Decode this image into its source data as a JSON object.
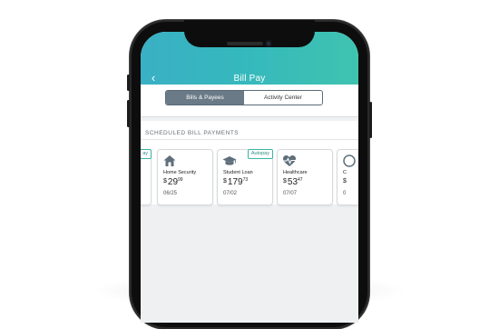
{
  "header": {
    "title": "Bill Pay",
    "back_icon": "chevron-left-icon"
  },
  "tabs": [
    {
      "label": "Bills & Payees",
      "active": true
    },
    {
      "label": "Activity Center",
      "active": false
    }
  ],
  "section": {
    "title": "SCHEDULED BILL PAYMENTS"
  },
  "cards": [
    {
      "name": "",
      "currency": "",
      "dollars": "",
      "cents": "",
      "date": "",
      "badge": "ay",
      "icon": "partial-card"
    },
    {
      "name": "Home Security",
      "currency": "$",
      "dollars": "29",
      "cents": "99",
      "date": "06/25",
      "badge": "",
      "icon": "house-icon"
    },
    {
      "name": "Student Loan",
      "currency": "$",
      "dollars": "179",
      "cents": "73",
      "date": "07/02",
      "badge": "Autopay",
      "icon": "graduation-cap-icon"
    },
    {
      "name": "Healthcare",
      "currency": "$",
      "dollars": "53",
      "cents": "47",
      "date": "07/07",
      "badge": "",
      "icon": "heart-pulse-icon"
    },
    {
      "name": "C",
      "currency": "$",
      "dollars": "",
      "cents": "",
      "date": "0",
      "badge": "",
      "icon": "partial-icon"
    }
  ],
  "colors": {
    "header_start": "#3ab0c4",
    "header_end": "#3fc3b0",
    "active_tab": "#6a7a86",
    "autopay": "#3cb4a6"
  }
}
